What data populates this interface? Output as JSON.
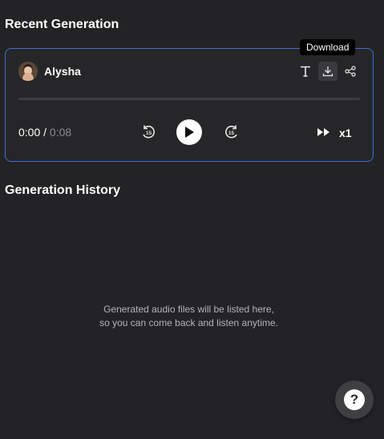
{
  "recent": {
    "title": "Recent Generation",
    "voice_name": "Alysha",
    "tooltip": "Download",
    "time_current": "0:00",
    "time_separator": " / ",
    "time_total": "0:08",
    "progress": 0,
    "skip_back_seconds": "15",
    "skip_forward_seconds": "15",
    "speed_label": "x1",
    "icons": {
      "text": "text-icon",
      "download": "download-icon",
      "share": "share-icon",
      "rewind": "rewind-15-icon",
      "play": "play-icon",
      "forward": "forward-15-icon",
      "speed": "fast-forward-icon"
    }
  },
  "history": {
    "title": "Generation History",
    "empty_line1": "Generated audio files will be listed here,",
    "empty_line2": "so you can come back and listen anytime."
  },
  "help": {
    "label": "?",
    "icon": "help-icon"
  },
  "colors": {
    "background": "#232325",
    "card_border": "#3b6fd4",
    "muted_text": "#8a8a8d"
  }
}
